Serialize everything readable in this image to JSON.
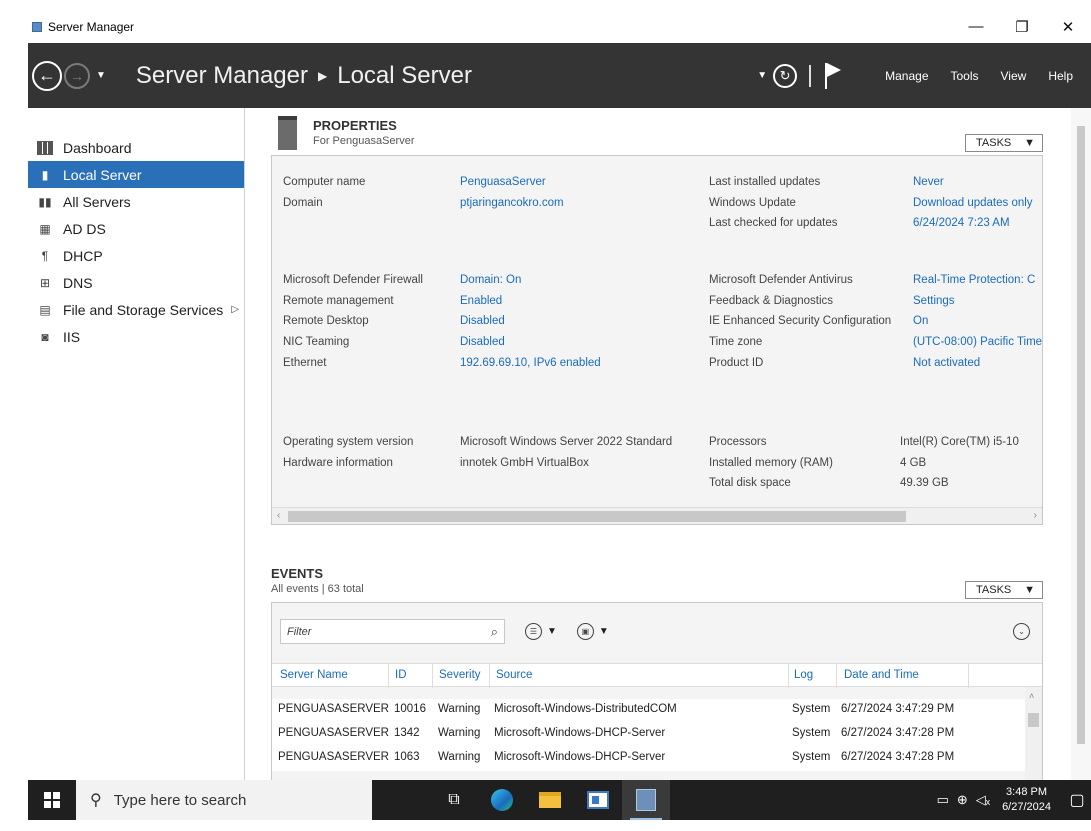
{
  "window": {
    "title": "Server Manager",
    "controls": [
      "—",
      "❐",
      "✕"
    ]
  },
  "header": {
    "app_name": "Server Manager",
    "page": "Local Server",
    "menu": [
      "Manage",
      "Tools",
      "View",
      "Help"
    ]
  },
  "sidebar": {
    "items": [
      {
        "label": "Dashboard",
        "icon": "dashboard-icon",
        "active": false
      },
      {
        "label": "Local Server",
        "icon": "local-server-icon",
        "active": true
      },
      {
        "label": "All Servers",
        "icon": "all-servers-icon",
        "active": false
      },
      {
        "label": "AD DS",
        "icon": "adds-icon",
        "active": false
      },
      {
        "label": "DHCP",
        "icon": "dhcp-icon",
        "active": false
      },
      {
        "label": "DNS",
        "icon": "dns-icon",
        "active": false
      },
      {
        "label": "File and Storage Services",
        "icon": "file-storage-icon",
        "active": false,
        "has_submenu": true
      },
      {
        "label": "IIS",
        "icon": "iis-icon",
        "active": false
      }
    ]
  },
  "properties": {
    "title": "PROPERTIES",
    "subtitle": "For PenguasaServer",
    "tasks_label": "TASKS",
    "left": [
      {
        "label": "Computer name",
        "value": "PenguasaServer"
      },
      {
        "label": "Domain",
        "value": "ptjaringancokro.com"
      },
      {
        "label": "Microsoft Defender Firewall",
        "value": "Domain: On"
      },
      {
        "label": "Remote management",
        "value": "Enabled"
      },
      {
        "label": "Remote Desktop",
        "value": "Disabled"
      },
      {
        "label": "NIC Teaming",
        "value": "Disabled"
      },
      {
        "label": "Ethernet",
        "value": "192.69.69.10, IPv6 enabled"
      },
      {
        "label": "Operating system version",
        "value": "Microsoft Windows Server 2022 Standard"
      },
      {
        "label": "Hardware information",
        "value": "innotek GmbH VirtualBox"
      }
    ],
    "right": [
      {
        "label": "Last installed updates",
        "value": "Never"
      },
      {
        "label": "Windows Update",
        "value": "Download updates only"
      },
      {
        "label": "Last checked for updates",
        "value": "6/24/2024 7:23 AM"
      },
      {
        "label": "Microsoft Defender Antivirus",
        "value": "Real-Time Protection: C"
      },
      {
        "label": "Feedback & Diagnostics",
        "value": "Settings"
      },
      {
        "label": "IE Enhanced Security Configuration",
        "value": "On"
      },
      {
        "label": "Time zone",
        "value": "(UTC-08:00) Pacific Time"
      },
      {
        "label": "Product ID",
        "value": "Not activated"
      },
      {
        "label": "Processors",
        "value": "Intel(R) Core(TM) i5-10"
      },
      {
        "label": "Installed memory (RAM)",
        "value": "4 GB"
      },
      {
        "label": "Total disk space",
        "value": "49.39 GB"
      }
    ]
  },
  "events": {
    "title": "EVENTS",
    "subtitle": "All events | 63 total",
    "tasks_label": "TASKS",
    "filter_placeholder": "Filter",
    "columns": [
      "Server Name",
      "ID",
      "Severity",
      "Source",
      "Log",
      "Date and Time"
    ],
    "rows": [
      [
        "PENGUASASERVER",
        "10016",
        "Warning",
        "Microsoft-Windows-DistributedCOM",
        "System",
        "6/27/2024 3:47:29 PM"
      ],
      [
        "PENGUASASERVER",
        "1342",
        "Warning",
        "Microsoft-Windows-DHCP-Server",
        "System",
        "6/27/2024 3:47:28 PM"
      ],
      [
        "PENGUASASERVER",
        "1063",
        "Warning",
        "Microsoft-Windows-DHCP-Server",
        "System",
        "6/27/2024 3:47:28 PM"
      ]
    ]
  },
  "taskbar": {
    "search_placeholder": "Type here to search",
    "time": "3:48 PM",
    "date": "6/27/2024"
  }
}
